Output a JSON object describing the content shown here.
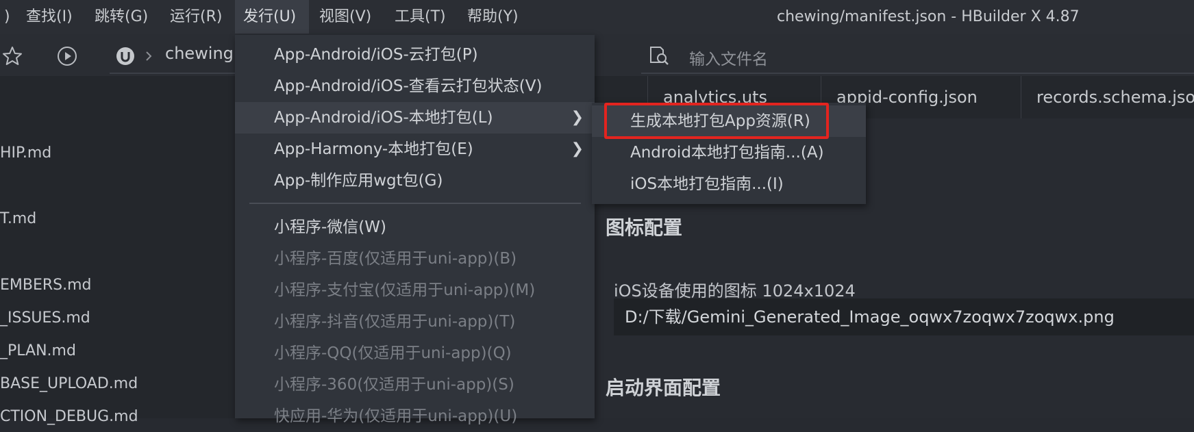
{
  "window": {
    "title": "chewing/manifest.json - HBuilder X 4.87"
  },
  "menubar": {
    "items": [
      {
        "label": ")"
      },
      {
        "label": "查找(I)"
      },
      {
        "label": "跳转(G)"
      },
      {
        "label": "运行(R)"
      },
      {
        "label": "发行(U)"
      },
      {
        "label": "视图(V)"
      },
      {
        "label": "工具(T)"
      },
      {
        "label": "帮助(Y)"
      }
    ]
  },
  "toolbar": {
    "project_name": "chewing",
    "search_placeholder": "输入文件名"
  },
  "sidebar": {
    "files": [
      {
        "name": "HIP.md"
      },
      {
        "name": "T.md"
      },
      {
        "name": "EMBERS.md"
      },
      {
        "name": "_ISSUES.md"
      },
      {
        "name": "_PLAN.md"
      },
      {
        "name": "BASE_UPLOAD.md"
      },
      {
        "name": "CTION_DEBUG.md"
      }
    ]
  },
  "tabs": [
    {
      "label": "analytics.uts"
    },
    {
      "label": "appid-config.json"
    },
    {
      "label": "records.schema.json"
    }
  ],
  "editor": {
    "icon_section_title": "图标配置",
    "ios_icon_label": "iOS设备使用的图标 1024x1024",
    "ios_icon_value": "D:/下载/Gemini_Generated_Image_oqwx7zoqwx7zoqwx.png",
    "splash_section_title": "启动界面配置"
  },
  "publish_menu": {
    "items": [
      {
        "label": "App-Android/iOS-云打包(P)"
      },
      {
        "label": "App-Android/iOS-查看云打包状态(V)"
      },
      {
        "label": "App-Android/iOS-本地打包(L)"
      },
      {
        "label": "App-Harmony-本地打包(E)"
      },
      {
        "label": "App-制作应用wgt包(G)"
      },
      {
        "label": "小程序-微信(W)"
      },
      {
        "label": "小程序-百度(仅适用于uni-app)(B)"
      },
      {
        "label": "小程序-支付宝(仅适用于uni-app)(M)"
      },
      {
        "label": "小程序-抖音(仅适用于uni-app)(T)"
      },
      {
        "label": "小程序-QQ(仅适用于uni-app)(Q)"
      },
      {
        "label": "小程序-360(仅适用于uni-app)(S)"
      },
      {
        "label": "快应用-华为(仅适用于uni-app)(U)"
      }
    ]
  },
  "local_pack_submenu": {
    "items": [
      {
        "label": "生成本地打包App资源(R)"
      },
      {
        "label": "Android本地打包指南...(A)"
      },
      {
        "label": "iOS本地打包指南...(I)"
      }
    ]
  },
  "colors": {
    "menu_bg": "#30343b",
    "highlight_border": "#e3241f",
    "disabled_text": "#7b7f86"
  }
}
